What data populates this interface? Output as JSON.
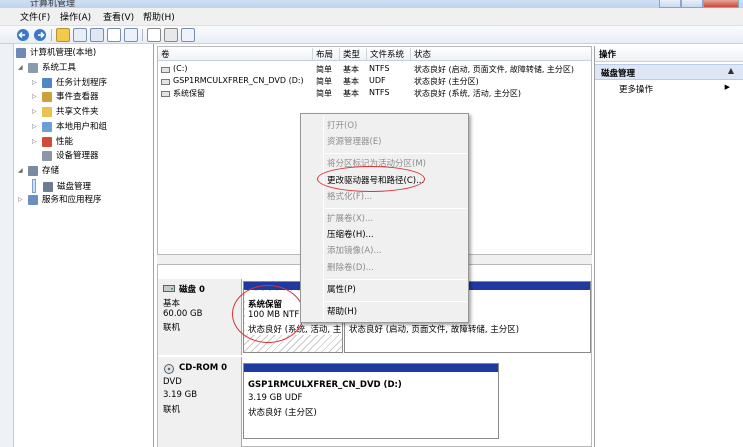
{
  "window": {
    "title": "计算机管理"
  },
  "menubar": [
    "文件(F)",
    "操作(A)",
    "查看(V)",
    "帮助(H)"
  ],
  "tree": {
    "root": "计算机管理(本地)",
    "items": [
      {
        "label": "系统工具",
        "level": 1,
        "icon": "tools-icon"
      },
      {
        "label": "任务计划程序",
        "level": 2,
        "icon": "clock-icon"
      },
      {
        "label": "事件查看器",
        "level": 2,
        "icon": "event-icon"
      },
      {
        "label": "共享文件夹",
        "level": 2,
        "icon": "folder-icon"
      },
      {
        "label": "本地用户和组",
        "level": 2,
        "icon": "users-icon"
      },
      {
        "label": "性能",
        "level": 2,
        "icon": "performance-icon"
      },
      {
        "label": "设备管理器",
        "level": 2,
        "icon": "device-icon"
      },
      {
        "label": "存储",
        "level": 1,
        "icon": "storage-icon"
      },
      {
        "label": "磁盘管理",
        "level": 2,
        "icon": "disk-icon",
        "selected": true
      },
      {
        "label": "服务和应用程序",
        "level": 1,
        "icon": "services-icon"
      }
    ]
  },
  "volumes": {
    "columns": [
      "卷",
      "布局",
      "类型",
      "文件系统",
      "状态"
    ],
    "rows": [
      {
        "name": "(C:)",
        "layout": "简单",
        "type": "基本",
        "fs": "NTFS",
        "status": "状态良好 (启动, 页面文件, 故障转储, 主分区)"
      },
      {
        "name": "GSP1RMCULXFRER_CN_DVD (D:)",
        "layout": "简单",
        "type": "基本",
        "fs": "UDF",
        "status": "状态良好 (主分区)"
      },
      {
        "name": "系统保留",
        "layout": "简单",
        "type": "基本",
        "fs": "NTFS",
        "status": "状态良好 (系统, 活动, 主分区)"
      }
    ]
  },
  "disks": [
    {
      "name": "磁盘 0",
      "kind": "基本",
      "size": "60.00 GB",
      "state": "联机",
      "partitions": [
        {
          "title": "系统保留",
          "size": "100 MB NTF",
          "status": "状态良好 (系统, 活动, 主"
        },
        {
          "title": "",
          "size": "",
          "status": "状态良好 (启动, 页面文件, 故障转储, 主分区)"
        }
      ]
    },
    {
      "name": "CD-ROM 0",
      "kind": "DVD",
      "size": "3.19 GB",
      "state": "联机",
      "partitions": [
        {
          "title": "GSP1RMCULXFRER_CN_DVD  (D:)",
          "size": "3.19 GB UDF",
          "status": "状态良好 (主分区)"
        }
      ]
    }
  ],
  "actions": {
    "header": "操作",
    "section": "磁盘管理",
    "more": "更多操作"
  },
  "context_menu": [
    {
      "label": "打开(O)",
      "disabled": true
    },
    {
      "label": "资源管理器(E)",
      "disabled": true
    },
    {
      "sep": true
    },
    {
      "label": "将分区标记为活动分区(M)",
      "disabled": true
    },
    {
      "label": "更改驱动器号和路径(C)...",
      "disabled": false,
      "highlight": true
    },
    {
      "label": "格式化(F)...",
      "disabled": true
    },
    {
      "sep": true
    },
    {
      "label": "扩展卷(X)...",
      "disabled": true
    },
    {
      "label": "压缩卷(H)...",
      "disabled": false
    },
    {
      "label": "添加镜像(A)...",
      "disabled": true
    },
    {
      "label": "删除卷(D)...",
      "disabled": true
    },
    {
      "sep": true
    },
    {
      "label": "属性(P)",
      "disabled": false
    },
    {
      "sep": true
    },
    {
      "label": "帮助(H)",
      "disabled": false
    }
  ],
  "colors": {
    "partition_bar": "#1e3a9e",
    "highlight_circle": "#d6323a",
    "selection": "#cce4f7"
  }
}
